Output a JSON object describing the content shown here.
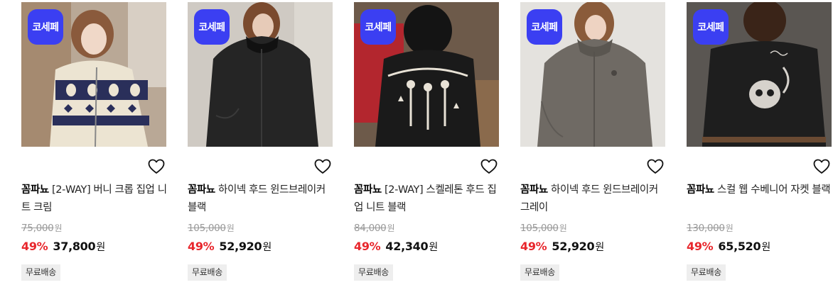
{
  "products": [
    {
      "badge": "코세페",
      "brand": "꼼파뇨",
      "name": "[2-WAY] 버니 크롭 집업 니트 크림",
      "original_price": "75,000",
      "original_unit": "원",
      "discount": "49%",
      "sale_price": "37,800",
      "sale_unit": "원",
      "shipping": "무료배송",
      "image": "model-cream-bunny-knit-cardigan"
    },
    {
      "badge": "코세페",
      "brand": "꼼파뇨",
      "name": "하이넥 후드 윈드브레이커 블랙",
      "original_price": "105,000",
      "original_unit": "원",
      "discount": "49%",
      "sale_price": "52,920",
      "sale_unit": "원",
      "shipping": "무료배송",
      "image": "model-black-hooded-windbreaker"
    },
    {
      "badge": "코세페",
      "brand": "꼼파뇨",
      "name": "[2-WAY] 스켈레톤 후드 집업 니트 블랙",
      "original_price": "84,000",
      "original_unit": "원",
      "discount": "49%",
      "sale_price": "42,340",
      "sale_unit": "원",
      "shipping": "무료배송",
      "image": "model-back-skeleton-knit-hoodie"
    },
    {
      "badge": "코세페",
      "brand": "꼼파뇨",
      "name": "하이넥 후드 윈드브레이커 그레이",
      "original_price": "105,000",
      "original_unit": "원",
      "discount": "49%",
      "sale_price": "52,920",
      "sale_unit": "원",
      "shipping": "무료배송",
      "image": "model-grey-hooded-windbreaker"
    },
    {
      "badge": "코세페",
      "brand": "꼼파뇨",
      "name": "스컬 웹 수베니어 자켓 블랙",
      "original_price": "130,000",
      "original_unit": "원",
      "discount": "49%",
      "sale_price": "65,520",
      "sale_unit": "원",
      "shipping": "무료배송",
      "image": "model-back-skull-souvenir-jacket"
    }
  ],
  "colors": {
    "badge_bg": "#3b3ff2",
    "discount": "#e8262c",
    "strike": "#999999",
    "shipping_bg": "#eeeeee"
  },
  "icons": {
    "wishlist": "heart-outline-icon"
  }
}
